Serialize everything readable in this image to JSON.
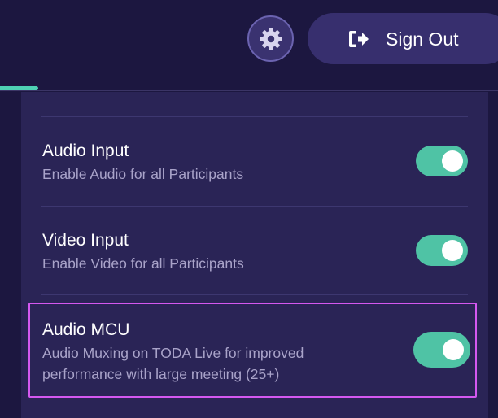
{
  "header": {
    "settings_icon": "gear-icon",
    "sign_out": {
      "label": "Sign Out",
      "icon": "sign-out-icon"
    }
  },
  "colors": {
    "background": "#1c1740",
    "panel": "#2a2456",
    "accent": "#4fd1b4",
    "toggle_on": "#4fc3a5",
    "highlight": "#d458f0",
    "button": "#372f6e"
  },
  "settings": [
    {
      "title": "Audio Input",
      "description": "Enable Audio for all Participants",
      "enabled": true
    },
    {
      "title": "Video Input",
      "description": "Enable Video for all Participants",
      "enabled": true
    },
    {
      "title": "Audio MCU",
      "description_line1": "Audio Muxing on TODA Live for improved",
      "description_line2": "performance with large meeting (25+)",
      "enabled": true,
      "highlighted": true
    }
  ]
}
